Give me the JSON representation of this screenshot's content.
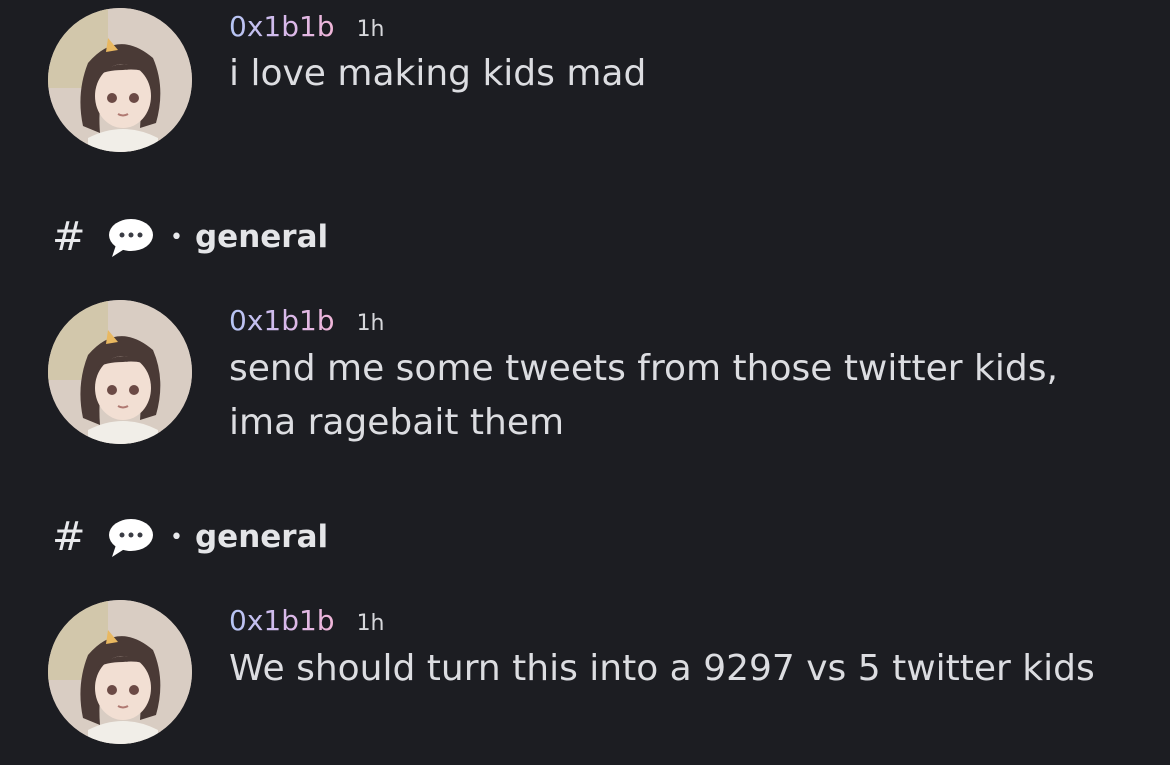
{
  "messages": [
    {
      "username": "0x1b1b",
      "time": "1h",
      "text": "i love making kids mad"
    },
    {
      "username": "0x1b1b",
      "time": "1h",
      "text": "send me some tweets from those twitter kids, ima ragebait them"
    },
    {
      "username": "0x1b1b",
      "time": "1h",
      "text": "We should turn this into a 9297 vs 5 twitter kids"
    }
  ],
  "channel_rows": [
    {
      "hash": "#",
      "separator": "•",
      "channel": "general"
    },
    {
      "hash": "#",
      "separator": "•",
      "channel": "general"
    }
  ],
  "colors": {
    "background": "#1c1d22",
    "text": "#dcdde1",
    "username_gradient": [
      "#b5c6f5",
      "#d8b8ea",
      "#f1b6d8"
    ]
  },
  "icons": [
    "hash-icon",
    "speech-bubble-icon",
    "avatar"
  ]
}
